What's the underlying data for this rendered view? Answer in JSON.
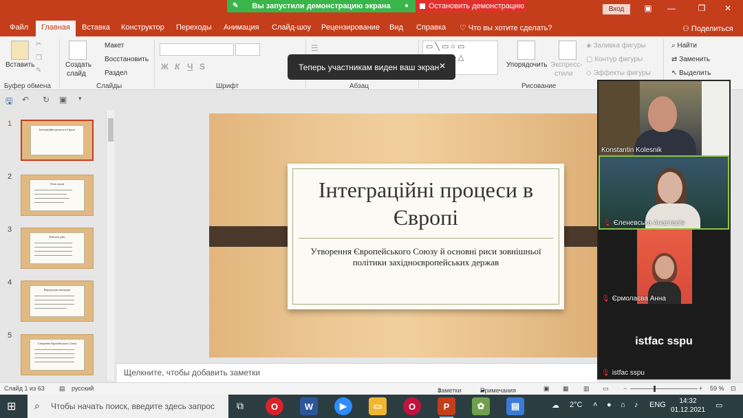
{
  "share": {
    "status": "Вы запустили демонстрацию экрана",
    "stop": "Остановить демонстрацию",
    "toast": "Теперь участникам виден ваш экран"
  },
  "titlebar": {
    "signin": "Вход"
  },
  "menu": {
    "tabs": [
      "Файл",
      "Главная",
      "Вставка",
      "Конструктор",
      "Переходы",
      "Анимация",
      "Слайд-шоу",
      "Рецензирование",
      "Вид",
      "Справка"
    ],
    "search": "Что вы хотите сделать?",
    "share": "Поделиться"
  },
  "ribbon": {
    "paste": "Вставить",
    "new_slide_1": "Создать",
    "new_slide_2": "слайд",
    "layout": "Макет",
    "reset": "Восстановить",
    "section": "Раздел",
    "format_bold": "Ж",
    "format_italic": "К",
    "format_underline": "Ч",
    "format_strike": "S",
    "arrange": "Упорядочить",
    "express_1": "Экспресс-",
    "express_2": "стили",
    "shape_fill": "Заливка фигуры",
    "shape_outline": "Контур фигуры",
    "shape_effects": "Эффекты фигуры",
    "find": "Найти",
    "replace": "Заменить",
    "select": "Выделить",
    "groups": {
      "clipboard": "Буфер обмена",
      "slides": "Слайды",
      "font": "Шрифт",
      "paragraph": "Абзац",
      "drawing": "Рисование"
    }
  },
  "thumbnails": [
    {
      "num": "1",
      "title": "Інтеграційні процеси в Європі",
      "selected": true
    },
    {
      "num": "2",
      "title": "План лекції",
      "selected": false
    },
    {
      "num": "3",
      "title": "Ключові дати",
      "selected": false
    },
    {
      "num": "4",
      "title": "Передумови інтеграції",
      "selected": false
    },
    {
      "num": "5",
      "title": "Створення Європейського Союзу",
      "selected": false
    }
  ],
  "slide": {
    "title": "Інтеграційні процеси в Європі",
    "subtitle": "Утворення Європейського Союзу й основні риси зовнішньої політики західноєвропейських держав"
  },
  "notes": "Щелкните, чтобы добавить заметки",
  "participants": [
    {
      "name": "Konstantin Kolesnik",
      "muted": false
    },
    {
      "name": "Єленевська Анастасія",
      "muted": true
    },
    {
      "name": "Єрмолаєва Анна",
      "muted": true
    },
    {
      "name": "istfac sspu",
      "muted": true,
      "avatar_text": "istfac sspu"
    }
  ],
  "statusbar": {
    "slide_info": "Слайд 1 из 63",
    "language": "русский",
    "notes_btn": "Заметки",
    "comments_btn": "Примечания",
    "zoom": "59 %"
  },
  "taskbar": {
    "search_placeholder": "Чтобы начать поиск, введите здесь запрос",
    "temperature": "2°C",
    "language": "ENG",
    "time": "14:32",
    "date": "01.12.2021"
  },
  "colors": {
    "accent": "#c43e1c",
    "share_green": "#3ab54a",
    "share_red": "#e0302b"
  }
}
